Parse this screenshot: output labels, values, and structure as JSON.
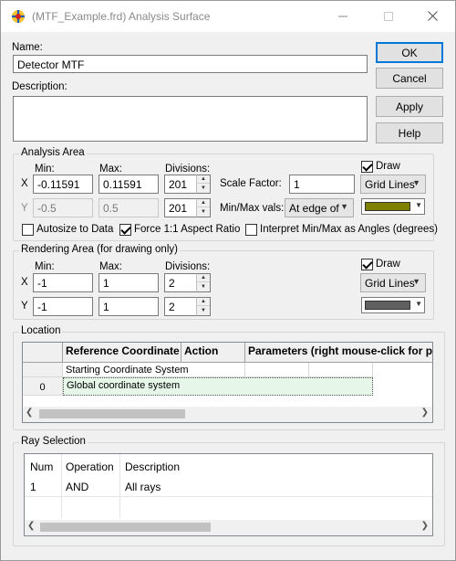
{
  "window": {
    "title": "(MTF_Example.frd) Analysis Surface",
    "minimize_glyph": "—",
    "maximize_glyph": "☐",
    "close_glyph": "✕"
  },
  "name": {
    "label": "Name:",
    "value": "Detector MTF"
  },
  "description": {
    "label": "Description:",
    "value": ""
  },
  "buttons": {
    "ok": "OK",
    "cancel": "Cancel",
    "apply": "Apply",
    "help": "Help"
  },
  "analysis_area": {
    "title": "Analysis Area",
    "min_label": "Min:",
    "max_label": "Max:",
    "divisions_label": "Divisions:",
    "x_label": "X",
    "y_label": "Y",
    "x_min": "-0.11591",
    "x_max": "0.11591",
    "x_div": "201",
    "y_min": "-0.5",
    "y_max": "0.5",
    "y_div": "201",
    "scale_factor_label": "Scale Factor:",
    "scale_factor": "1",
    "minmax_label": "Min/Max vals:",
    "minmax_value": "At edge of",
    "draw_label": "Draw",
    "draw_checked": true,
    "grid_style": "Grid Lines",
    "color": "#808000",
    "autosize_label": "Autosize to Data",
    "autosize_checked": false,
    "force_aspect_label": "Force 1:1 Aspect Ratio",
    "force_aspect_checked": true,
    "interpret_label": "Interpret Min/Max as Angles (degrees)",
    "interpret_checked": false
  },
  "rendering_area": {
    "title": "Rendering Area (for drawing only)",
    "min_label": "Min:",
    "max_label": "Max:",
    "divisions_label": "Divisions:",
    "x_label": "X",
    "y_label": "Y",
    "x_min": "-1",
    "x_max": "1",
    "x_div": "2",
    "y_min": "-1",
    "y_max": "1",
    "y_div": "2",
    "draw_label": "Draw",
    "draw_checked": true,
    "grid_style": "Grid Lines",
    "color": "#606060"
  },
  "location": {
    "title": "Location",
    "headers": [
      "Reference Coordinate",
      "Action",
      "Parameters (right mouse-click for po"
    ],
    "row_starting": "Starting Coordinate System",
    "row_index": "0",
    "row_global": "Global coordinate system"
  },
  "ray_selection": {
    "title": "Ray Selection",
    "headers": [
      "Num",
      "Operation",
      "Description"
    ],
    "rows": [
      {
        "num": "1",
        "operation": "AND",
        "description": "All rays"
      }
    ]
  }
}
